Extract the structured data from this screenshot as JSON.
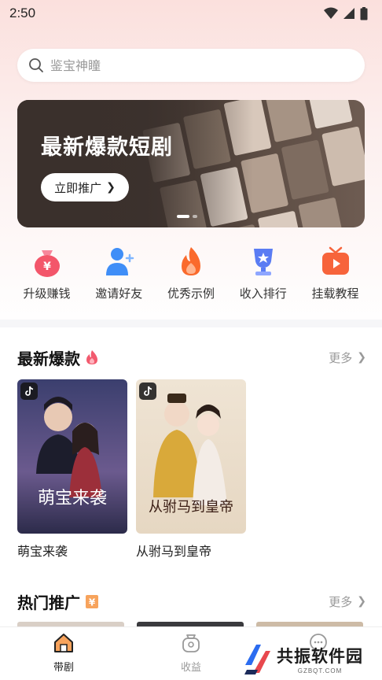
{
  "status_bar": {
    "time": "2:50"
  },
  "search": {
    "placeholder": "鉴宝神瞳",
    "icon": "search-icon"
  },
  "banner": {
    "title": "最新爆款短剧",
    "button_label": "立即推广",
    "slide_count": 2,
    "active_slide": 1
  },
  "quick_menu": [
    {
      "label": "升级赚钱",
      "icon": "money-bag-icon",
      "color": "#f3566a"
    },
    {
      "label": "邀请好友",
      "icon": "invite-user-icon",
      "color": "#3f8ef7"
    },
    {
      "label": "优秀示例",
      "icon": "flame-icon",
      "color": "#fa6a2c"
    },
    {
      "label": "收入排行",
      "icon": "trophy-icon",
      "color": "#5a7cf3"
    },
    {
      "label": "挂载教程",
      "icon": "tv-play-icon",
      "color": "#f7643b"
    }
  ],
  "section_new": {
    "title": "最新爆款",
    "icon": "flame-icon",
    "more_label": "更多",
    "items": [
      {
        "title": "萌宝来袭",
        "poster_text": "萌宝来袭",
        "platform_icon": "tiktok-icon"
      },
      {
        "title": "从驸马到皇帝",
        "poster_text": "从驸马到皇帝",
        "platform_icon": "tiktok-icon"
      }
    ]
  },
  "section_hot": {
    "title": "热门推广",
    "icon": "yen-ticket-icon",
    "more_label": "更多"
  },
  "bottom_nav": {
    "items": [
      {
        "label": "带剧",
        "icon": "home-drama-icon",
        "active": true
      },
      {
        "label": "收益",
        "icon": "money-pot-icon",
        "active": false
      },
      {
        "label": "",
        "icon": "chat-icon",
        "active": false
      }
    ]
  },
  "watermark": {
    "main": "共振软件园",
    "sub": "GZBQT.COM"
  },
  "colors": {
    "accent": "#fa6a2c",
    "banner_bg": "#3a302c",
    "text_muted": "#999999"
  }
}
